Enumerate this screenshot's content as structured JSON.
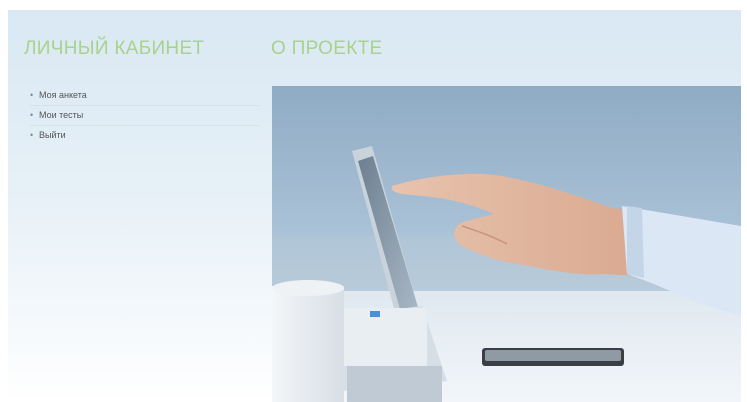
{
  "sidebar": {
    "title": "ЛИЧНЫЙ КАБИНЕТ",
    "items": [
      {
        "label": "Моя анкета"
      },
      {
        "label": "Мои тесты"
      },
      {
        "label": "Выйти"
      }
    ]
  },
  "main": {
    "title": "О ПРОЕКТЕ"
  },
  "colors": {
    "accent": "#a9d28d",
    "panel_bg": "#dce9f4"
  },
  "hero_image": {
    "description_icon": "hand-touching-laptop-photo"
  }
}
